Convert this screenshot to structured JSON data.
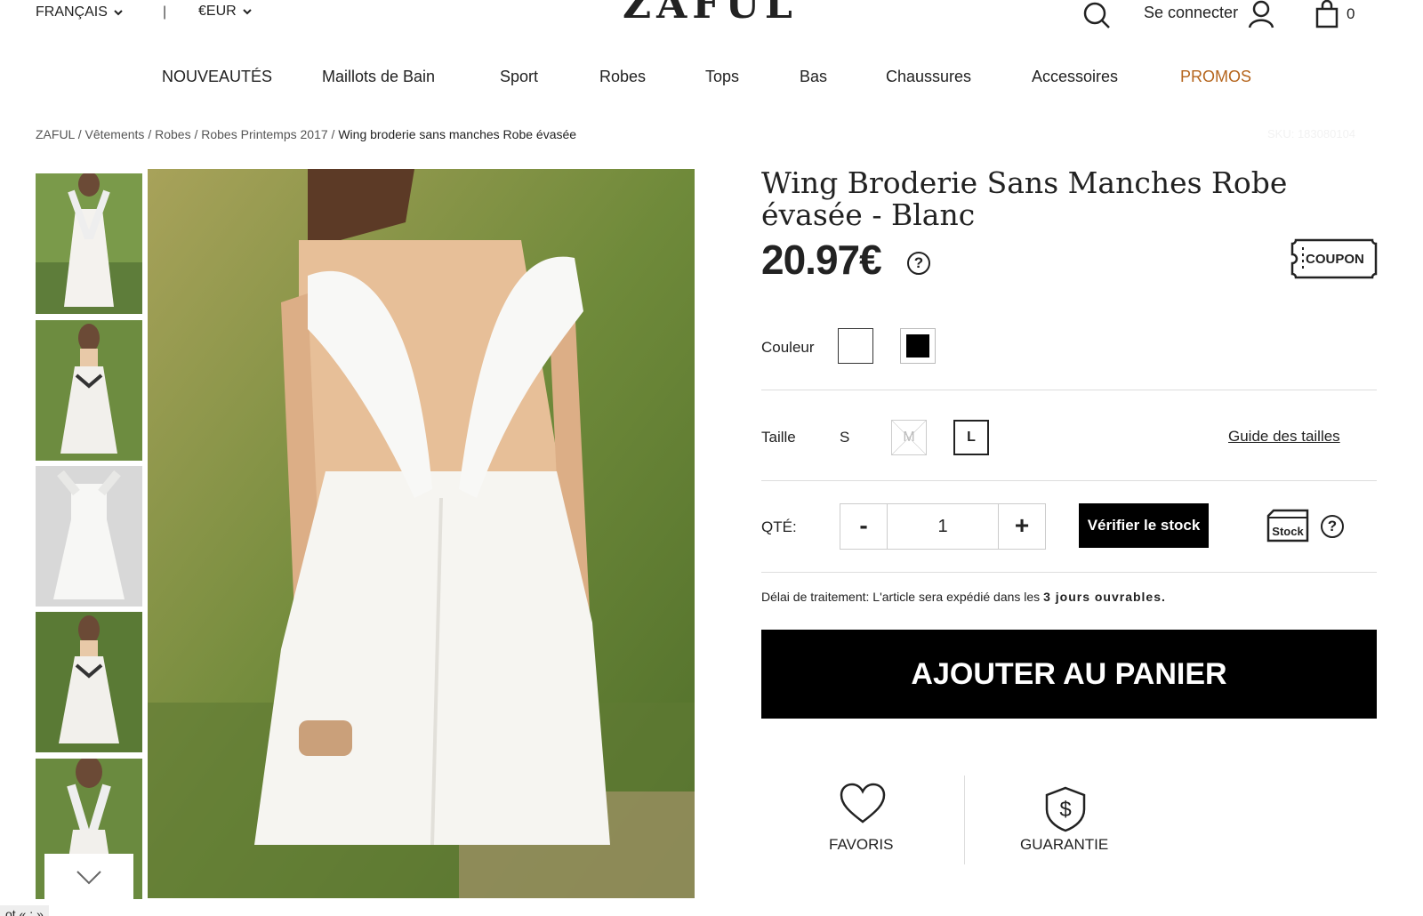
{
  "topbar": {
    "language": "FRANÇAIS",
    "separator": "|",
    "currency": "€EUR",
    "logo": "ZAFUL",
    "login": "Se connecter",
    "cart_count": "0"
  },
  "nav": {
    "items": [
      "NOUVEAUTÉS",
      "Maillots de Bain",
      "Sport",
      "Robes",
      "Tops",
      "Bas",
      "Chaussures",
      "Accessoires",
      "PROMOS"
    ],
    "promo_color": "#b5651d"
  },
  "breadcrumb": {
    "items": [
      "ZAFUL",
      "Vêtements",
      "Robes",
      "Robes Printemps 2017"
    ],
    "sep": " / ",
    "current": "Wing broderie sans manches Robe évasée",
    "sku": "SKU: 183080104"
  },
  "product": {
    "title": "Wing Broderie Sans Manches Robe évasée - Blanc",
    "price": "20.97€",
    "price_help": "?",
    "coupon": "COUPON",
    "color_label": "Couleur",
    "colors": [
      "#ffffff",
      "#000000"
    ],
    "size_label": "Taille",
    "sizes": [
      "S",
      "M",
      "L"
    ],
    "size_guide": "Guide des tailles",
    "qty_label": "QTÉ:",
    "qty_minus": "-",
    "qty_value": "1",
    "qty_plus": "+",
    "verify_stock": "Vérifier le stock",
    "stock_icon_text": "Stock",
    "stock_help": "?",
    "delay_prefix": "Délai de traitement: L'article sera expédié dans les ",
    "delay_bold": "3 jours ouvrables.",
    "add_to_cart": "AJOUTER AU PANIER",
    "favorites": "FAVORIS",
    "guarantee": "GUARANTIE"
  },
  "footer": {
    "js_tag": "ot « ; »"
  }
}
